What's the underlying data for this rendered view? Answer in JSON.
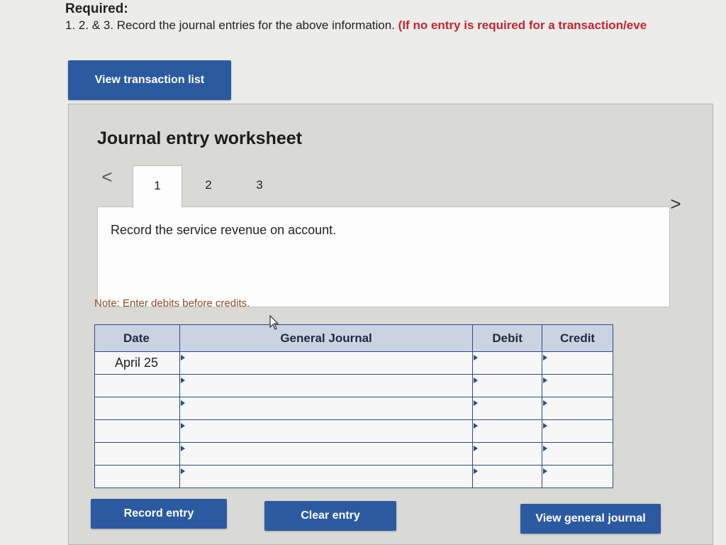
{
  "header": {
    "required": "Required:",
    "instruction": "1. 2. & 3. Record the journal entries for the above information.",
    "instruction_red": "(If no entry is required for a transaction/eve"
  },
  "buttons": {
    "view_transaction_list": "View transaction list",
    "record_entry": "Record entry",
    "clear_entry": "Clear entry",
    "view_general_journal": "View general journal"
  },
  "worksheet": {
    "title": "Journal entry worksheet",
    "nav_prev": "<",
    "nav_next": ">",
    "tabs": [
      {
        "label": "1",
        "active": true
      },
      {
        "label": "2",
        "active": false
      },
      {
        "label": "3",
        "active": false
      }
    ],
    "description": "Record the service revenue on account.",
    "note": "Note: Enter debits before credits."
  },
  "journal_table": {
    "headers": {
      "date": "Date",
      "general_journal": "General Journal",
      "debit": "Debit",
      "credit": "Credit"
    },
    "rows": [
      {
        "date": "April 25",
        "account": "",
        "debit": "",
        "credit": ""
      },
      {
        "date": "",
        "account": "",
        "debit": "",
        "credit": ""
      },
      {
        "date": "",
        "account": "",
        "debit": "",
        "credit": ""
      },
      {
        "date": "",
        "account": "",
        "debit": "",
        "credit": ""
      },
      {
        "date": "",
        "account": "",
        "debit": "",
        "credit": ""
      },
      {
        "date": "",
        "account": "",
        "debit": "",
        "credit": ""
      }
    ]
  },
  "colors": {
    "accent": "#2c5aa0",
    "warning_text": "#c4262e",
    "table_header_bg": "#cbd3e3",
    "table_border": "#2c4c86"
  },
  "icons": {
    "cursor": "mouse-pointer-icon",
    "prev": "chevron-left-icon",
    "next": "chevron-right-icon"
  }
}
